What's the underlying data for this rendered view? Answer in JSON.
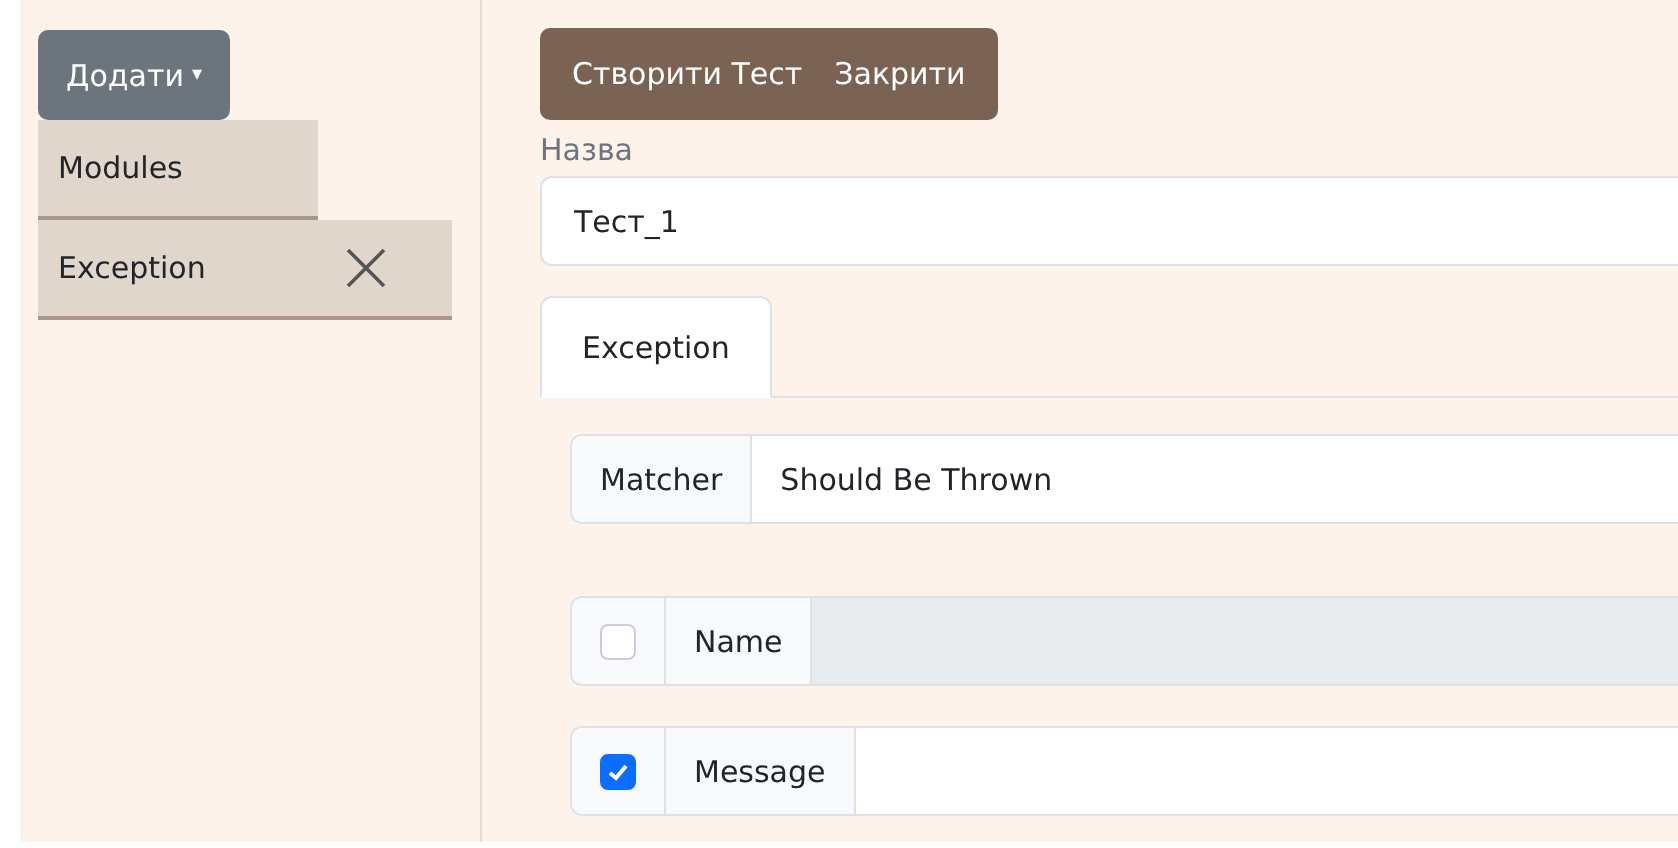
{
  "sidebar": {
    "add_button": {
      "label": "Додати",
      "caret": "▾"
    },
    "items": [
      {
        "label": "Modules",
        "closable": false
      },
      {
        "label": "Exception",
        "closable": true
      }
    ]
  },
  "toolbar": {
    "buttons": [
      "Створити Тест",
      "Закрити"
    ]
  },
  "name_field": {
    "label": "Назва",
    "value": "Тест_1"
  },
  "tabs": [
    {
      "label": "Exception",
      "selected": true
    }
  ],
  "matcher": {
    "label": "Matcher",
    "value": "Should Be Thrown"
  },
  "fields": [
    {
      "label": "Name",
      "checked": false
    },
    {
      "label": "Message",
      "checked": true
    }
  ]
}
